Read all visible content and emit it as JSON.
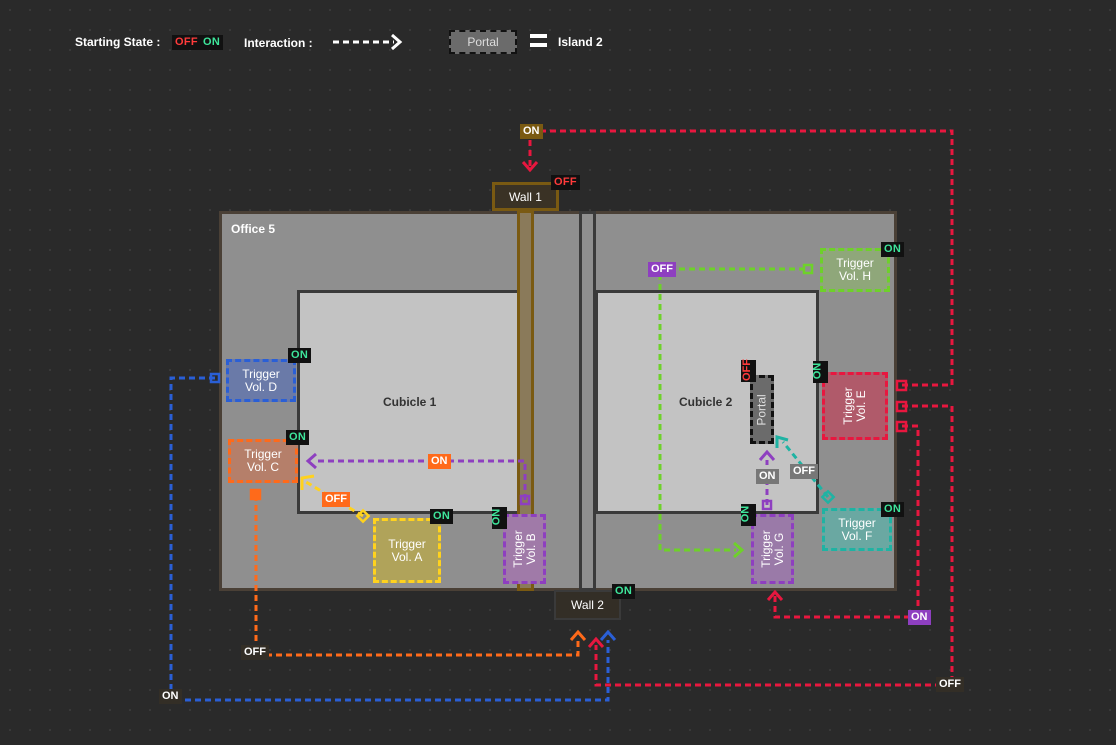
{
  "legend": {
    "starting_state_label": "Starting State :",
    "off": "OFF",
    "on": "ON",
    "interaction_label": "Interaction :",
    "portal_label": "Portal",
    "equals_label": "Island 2"
  },
  "office": {
    "title": "Office 5"
  },
  "cubicles": {
    "c1": "Cubicle 1",
    "c2": "Cubicle 2"
  },
  "walls": {
    "wall1": "Wall 1",
    "wall2": "Wall 2"
  },
  "portal": {
    "label": "Portal",
    "state": "OFF"
  },
  "triggers": {
    "a": {
      "line1": "Trigger",
      "line2": "Vol. A",
      "state": "ON"
    },
    "b": {
      "line1": "Trigger",
      "line2": "Vol. B",
      "state": "ON"
    },
    "c": {
      "line1": "Trigger",
      "line2": "Vol. C",
      "state": "ON"
    },
    "d": {
      "line1": "Trigger",
      "line2": "Vol. D",
      "state": "ON"
    },
    "e": {
      "line1": "Trigger",
      "line2": "Vol. E",
      "state": "ON"
    },
    "f": {
      "line1": "Trigger",
      "line2": "Vol. F",
      "state": "ON"
    },
    "g": {
      "line1": "Trigger",
      "line2": "Vol. G",
      "state": "ON"
    },
    "h": {
      "line1": "Trigger",
      "line2": "Vol. H",
      "state": "ON"
    }
  },
  "wall_states": {
    "wall1": "OFF",
    "wall2": "ON"
  },
  "action_tags": {
    "wall1_on": "ON",
    "b_to_c_on": "ON",
    "a_to_c_off": "OFF",
    "h_off": "OFF",
    "f_off": "OFF",
    "g_on": "ON",
    "e_to_g_on": "ON",
    "c_to_wall2_off": "OFF",
    "d_to_wall2_on": "ON",
    "e_to_wall2_off": "OFF"
  },
  "colors": {
    "red": "#e8173f",
    "orange": "#ff6a1a",
    "blue": "#2a5fd6",
    "yellow": "#ffd21e",
    "purple": "#8e3fc0",
    "green": "#6ed12a",
    "teal": "#1fb3a3",
    "wall": "#7a5a12"
  }
}
